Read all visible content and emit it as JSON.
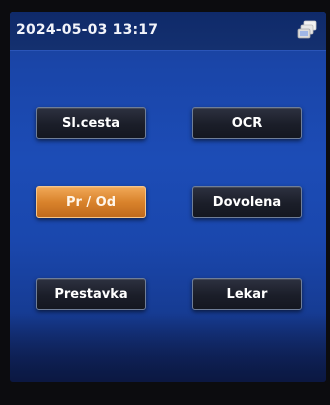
{
  "status_bar": {
    "datetime": "2024-05-03 13:17",
    "network_icon": "network-icon"
  },
  "buttons": [
    {
      "id": "sl-cesta",
      "label": "Sl.cesta",
      "active": false
    },
    {
      "id": "ocr",
      "label": "OCR",
      "active": false
    },
    {
      "id": "pr-od",
      "label": "Pr / Od",
      "active": true
    },
    {
      "id": "dovolena",
      "label": "Dovolena",
      "active": false
    },
    {
      "id": "prestavka",
      "label": "Prestavka",
      "active": false
    },
    {
      "id": "lekar",
      "label": "Lekar",
      "active": false
    }
  ],
  "colors": {
    "screen_blue": "#1c4cb6",
    "active_orange": "#d9832c",
    "button_dark": "#1b1e29"
  }
}
